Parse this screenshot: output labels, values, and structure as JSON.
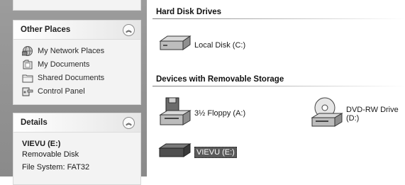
{
  "other_places": {
    "title": "Other Places",
    "collapse_glyph": "︽",
    "items": [
      {
        "label": "My Network Places",
        "icon": "network-places-icon"
      },
      {
        "label": "My Documents",
        "icon": "my-documents-icon"
      },
      {
        "label": "Shared Documents",
        "icon": "shared-folder-icon"
      },
      {
        "label": "Control Panel",
        "icon": "control-panel-icon"
      }
    ]
  },
  "details": {
    "title": "Details",
    "collapse_glyph": "︽",
    "name": "VIEVU (E:)",
    "type": "Removable Disk",
    "file_system": "File System: FAT32"
  },
  "content": {
    "hard_disk_header": "Hard Disk Drives",
    "removable_header": "Devices with Removable Storage",
    "drives": {
      "local_disk": "Local Disk (C:)",
      "floppy": "3½ Floppy (A:)",
      "dvd": "DVD-RW Drive (D:)",
      "vievu": "VIEVU (E:)"
    }
  }
}
